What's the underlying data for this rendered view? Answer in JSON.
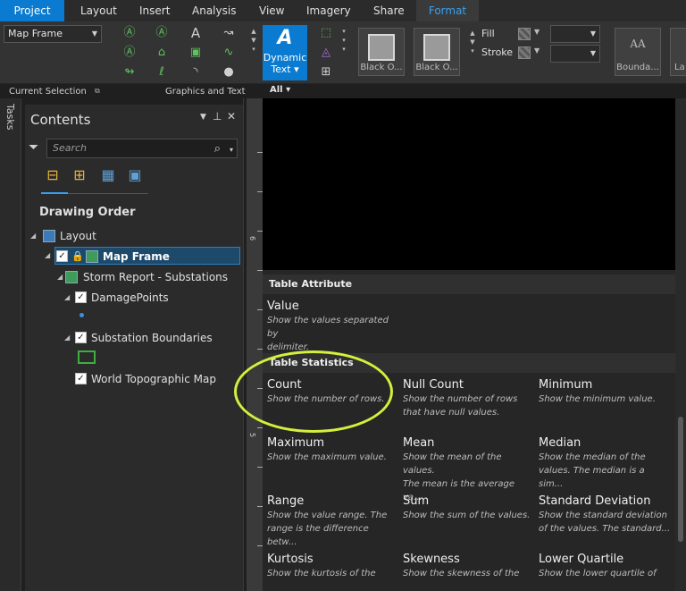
{
  "ribbon": {
    "tabs": [
      "Project",
      "Layout",
      "Insert",
      "Analysis",
      "View",
      "Imagery",
      "Share",
      "Format"
    ],
    "selection_dropdown": "Map Frame",
    "dynamic_text": {
      "line1": "Dynamic",
      "line2": "Text ▾"
    },
    "style_tiles": [
      "Black O...",
      "Black O..."
    ],
    "text_style_tile": {
      "glyph": "AA",
      "label": "Bounda...",
      "partial": "La"
    },
    "fill_label": "Fill",
    "stroke_label": "Stroke",
    "group_labels": {
      "current_selection": "Current Selection",
      "graphics_text": "Graphics and Text"
    },
    "all_label": "All ▾"
  },
  "tasks_label": "Tasks",
  "contents": {
    "title": "Contents",
    "search_placeholder": "Search",
    "drawing_order": "Drawing Order",
    "tree": [
      {
        "label": "Layout"
      },
      {
        "label": "Map Frame"
      },
      {
        "label": "Storm Report - Substations"
      },
      {
        "label": "DamagePoints"
      },
      {
        "label": "Substation Boundaries"
      },
      {
        "label": "World Topographic Map"
      }
    ]
  },
  "ruler_numbers": [
    "6",
    "5"
  ],
  "gallery": {
    "sections": [
      {
        "title": "Table Attribute",
        "items": [
          {
            "name": "Value",
            "desc": "Show the values separated by\ndelimiter."
          }
        ]
      },
      {
        "title": "Table Statistics",
        "items": [
          {
            "name": "Count",
            "desc": "Show the number of rows."
          },
          {
            "name": "Null Count",
            "desc": "Show the number of rows\nthat have null values."
          },
          {
            "name": "Minimum",
            "desc": "Show the minimum value."
          },
          {
            "name": "Maximum",
            "desc": "Show the maximum value."
          },
          {
            "name": "Mean",
            "desc": "Show the mean of the values.\nThe mean is the average va..."
          },
          {
            "name": "Median",
            "desc": "Show the median of the\nvalues. The median is a sim..."
          },
          {
            "name": "Range",
            "desc": "Show the value range. The\nrange is the difference betw..."
          },
          {
            "name": "Sum",
            "desc": "Show the sum of the values."
          },
          {
            "name": "Standard Deviation",
            "desc": "Show the standard deviation\nof the values. The standard..."
          },
          {
            "name": "Kurtosis",
            "desc": "Show the kurtosis of the"
          },
          {
            "name": "Skewness",
            "desc": "Show the skewness of the"
          },
          {
            "name": "Lower Quartile",
            "desc": "Show the lower quartile of"
          }
        ]
      }
    ]
  },
  "colors": {
    "accent": "#0a7bd0",
    "format_tab": "#39a0ef",
    "highlight": "#d6ef3c"
  }
}
